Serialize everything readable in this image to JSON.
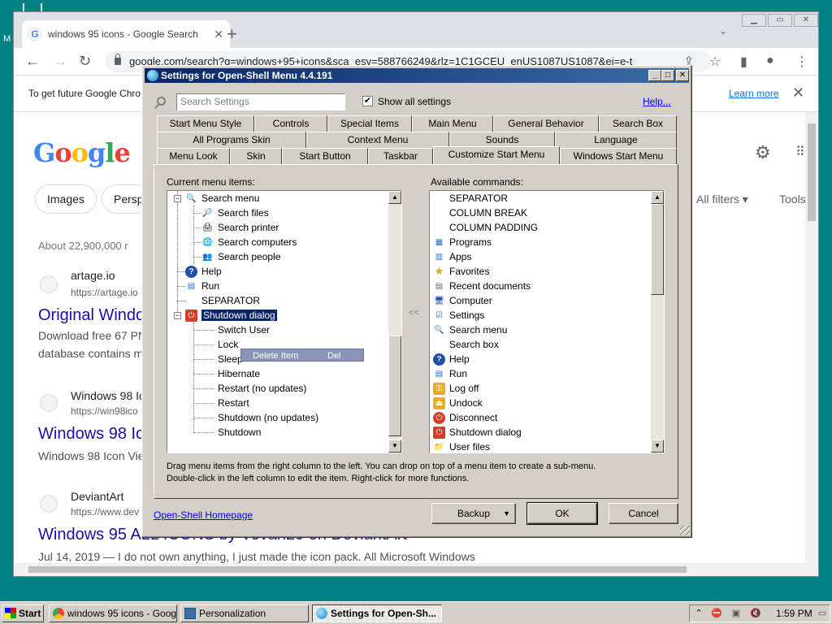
{
  "desktop": {
    "icon_label": "M"
  },
  "chrome": {
    "tab_title": "windows 95 icons - Google Search",
    "url": "google.com/search?q=windows+95+icons&sca_esv=588766249&rlz=1C1GCEU_enUS1087US1087&ei=e-t",
    "infobar_text": "To get future Google Chro",
    "infobar_link": "Learn more",
    "logo": "Google",
    "chips": [
      "Images",
      "Persp"
    ],
    "filters": [
      "All filters",
      "Tools"
    ],
    "results_count": "About 22,900,000 r",
    "results": [
      {
        "site": "artage.io",
        "url": "https://artage.io",
        "title": "Original Windo",
        "snippet1": "Download free 67 PN",
        "snippet2": "database contains m"
      },
      {
        "site": "Windows 98 Ic",
        "url": "https://win98ico",
        "title": "Windows 98 Ic",
        "snippet1": "Windows 98 Icon Vie"
      },
      {
        "site": "DeviantArt",
        "url": "https://www.dev",
        "title": "Windows 95 ALL ICONS by Vovan29 on DeviantArt",
        "snippet1": "Jul 14, 2019 — I do not own anything, I just made the icon pack. All Microsoft Windows"
      }
    ]
  },
  "dialog": {
    "title": "Settings for Open-Shell Menu 4.4.191",
    "search_placeholder": "Search Settings",
    "show_all_label": "Show all settings",
    "show_all_checked": "✔",
    "help_link": "Help...",
    "tabs_row1": [
      "Start Menu Style",
      "Controls",
      "Special Items",
      "Main Menu",
      "General Behavior",
      "Search Box"
    ],
    "tabs_row2": [
      "All Programs Skin",
      "Context Menu",
      "Sounds",
      "Language"
    ],
    "tabs_row3": [
      "Menu Look",
      "Skin",
      "Start Button",
      "Taskbar",
      "Customize Start Menu",
      "Windows Start Menu"
    ],
    "current_label": "Current menu items:",
    "available_label": "Available commands:",
    "current_items": [
      "Search menu",
      "Search files",
      "Search printer",
      "Search computers",
      "Search people",
      "Help",
      "Run",
      "SEPARATOR",
      "Shutdown dialog",
      "Switch User",
      "Lock",
      "Sleep",
      "Hibernate",
      "Restart (no updates)",
      "Restart",
      "Shutdown (no updates)",
      "Shutdown"
    ],
    "available_items": [
      "SEPARATOR",
      "COLUMN BREAK",
      "COLUMN PADDING",
      "Programs",
      "Apps",
      "Favorites",
      "Recent documents",
      "Computer",
      "Settings",
      "Search menu",
      "Search box",
      "Help",
      "Run",
      "Log off",
      "Undock",
      "Disconnect",
      "Shutdown dialog",
      "User files"
    ],
    "context_menu": {
      "label": "Delete Item",
      "shortcut": "Del"
    },
    "move_arrows": "<<",
    "hint_line1": "Drag menu items from the right column to the left. You can drop on top of a menu item to create a sub-menu.",
    "hint_line2": "Double-click in the left column to edit the item. Right-click for more functions.",
    "homepage_link": "Open-Shell Homepage",
    "buttons": {
      "backup": "Backup",
      "ok": "OK",
      "cancel": "Cancel"
    }
  },
  "taskbar": {
    "start": "Start",
    "tasks": [
      "windows 95 icons - Googl...",
      "Personalization",
      "Settings for Open-Sh..."
    ],
    "clock": "1:59 PM"
  },
  "colors": {
    "desktop": "#008080",
    "titlebar": "#0a246a",
    "selection": "#0a246a",
    "face": "#d4d0c8"
  }
}
